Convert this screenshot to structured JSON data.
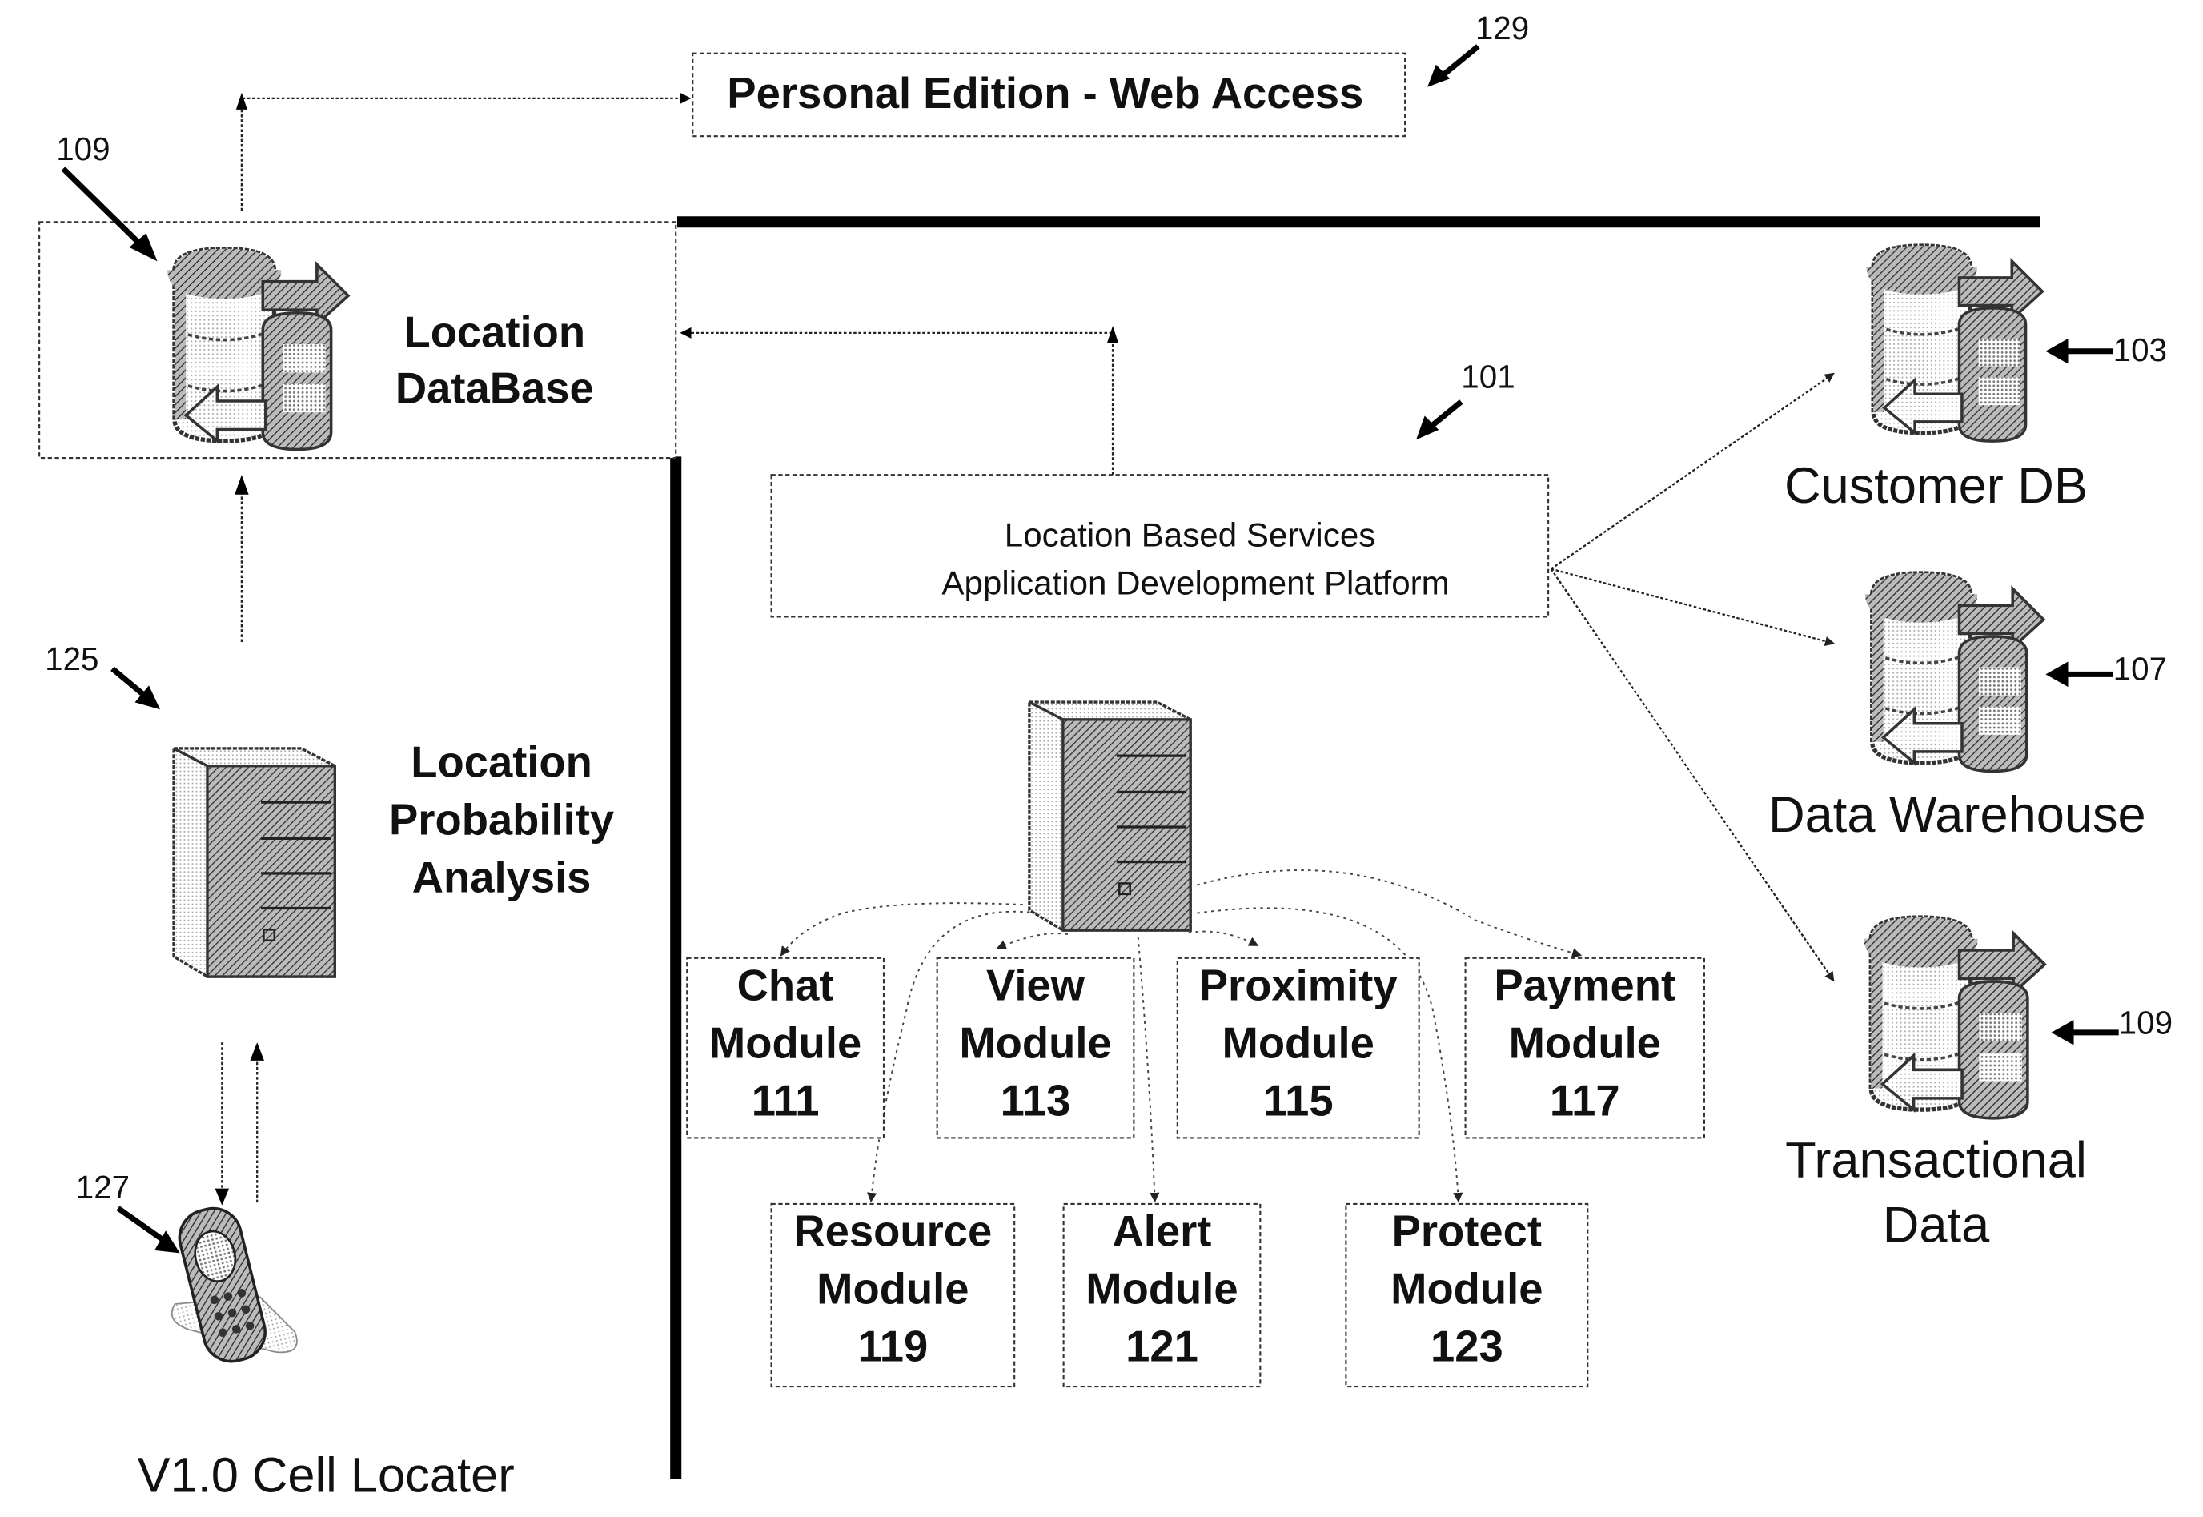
{
  "figure": {
    "top_box": {
      "label": "Personal Edition - Web Access",
      "ref": "129"
    },
    "location_db": {
      "line1": "Location",
      "line2": "DataBase",
      "ref": "109"
    },
    "probability": {
      "line1": "Location",
      "line2": "Probability",
      "line3": "Analysis",
      "ref": "125"
    },
    "cell_locater": {
      "label": "V1.0 Cell Locater",
      "ref": "127"
    },
    "platform": {
      "line1": "Location Based Services",
      "line2": "Application Development Platform",
      "ref": "101"
    },
    "databases": [
      {
        "line1": "Customer DB",
        "line2": "",
        "ref": "103"
      },
      {
        "line1": "Data Warehouse",
        "line2": "",
        "ref": "107"
      },
      {
        "line1": "Transactional",
        "line2": "Data",
        "ref": "109"
      }
    ],
    "modules": [
      {
        "name": "Chat",
        "word": "Module",
        "ref": "111"
      },
      {
        "name": "View",
        "word": "Module",
        "ref": "113"
      },
      {
        "name": "Proximity",
        "word": "Module",
        "ref": "115"
      },
      {
        "name": "Payment",
        "word": "Module",
        "ref": "117"
      },
      {
        "name": "Resource",
        "word": "Module",
        "ref": "119"
      },
      {
        "name": "Alert",
        "word": "Module",
        "ref": "121"
      },
      {
        "name": "Protect",
        "word": "Module",
        "ref": "123"
      }
    ]
  },
  "icons": {
    "database": "database-icon",
    "server": "server-icon",
    "phone": "cell-phone-icon"
  }
}
